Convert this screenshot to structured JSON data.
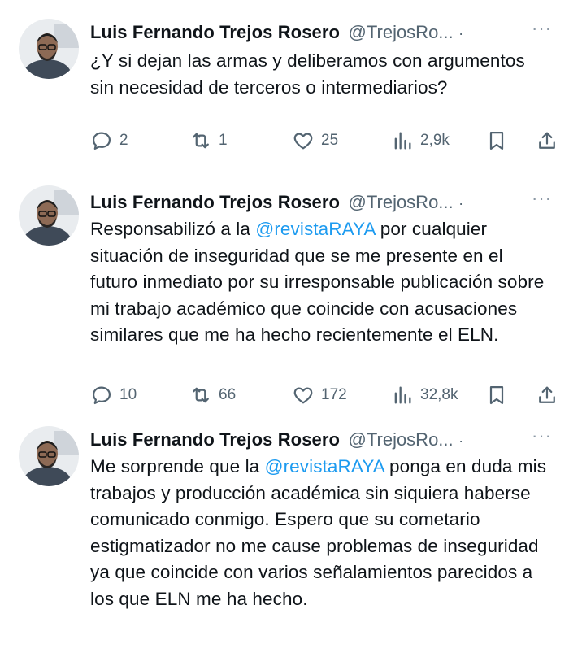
{
  "tweets": [
    {
      "name": "Luis Fernando Trejos Rosero",
      "handle": "@TrejosRo...",
      "separator": "·",
      "more": "···",
      "text_parts": [
        "¿Y si dejan las armas y deliberamos con argumentos sin necesidad de terceros o intermediarios?"
      ],
      "replies": "2",
      "retweets": "1",
      "likes": "25",
      "views": "2,9k"
    },
    {
      "name": "Luis Fernando Trejos Rosero",
      "handle": "@TrejosRo...",
      "separator": "·",
      "more": "···",
      "text_before": "Responsabilizó a la ",
      "mention": "@revistaRAYA",
      "text_after": " por cualquier situación de inseguridad que se me presente en el futuro inmediato por su irresponsable publicación sobre mi trabajo académico que coincide con acusaciones similares que me ha hecho recientemente el ELN.",
      "replies": "10",
      "retweets": "66",
      "likes": "172",
      "views": "32,8k"
    },
    {
      "name": "Luis Fernando Trejos Rosero",
      "handle": "@TrejosRo...",
      "separator": "·",
      "more": "···",
      "text_before": "Me sorprende que la ",
      "mention": "@revistaRAYA",
      "text_after": " ponga en duda mis trabajos y producción académica sin siquiera haberse comunicado conmigo. Espero que su cometario estigmatizador no me cause problemas de inseguridad ya que coincide con varios señalamientos parecidos a los que ELN me ha hecho."
    }
  ],
  "icons": {
    "reply": "reply-icon",
    "retweet": "retweet-icon",
    "like": "heart-icon",
    "views": "views-icon",
    "bookmark": "bookmark-icon",
    "share": "share-icon"
  },
  "colors": {
    "mention": "#1d9bf0",
    "secondary": "#536471"
  }
}
